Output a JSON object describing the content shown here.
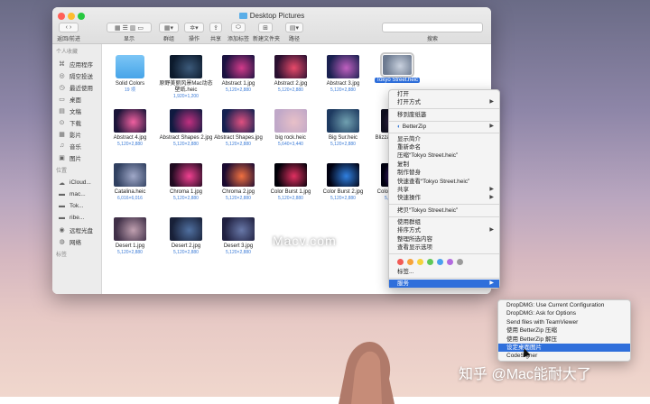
{
  "window": {
    "title": "Desktop Pictures",
    "toolbar_labels": {
      "back_forward": "返回/前进",
      "view": "显示",
      "group": "群组",
      "action": "操作",
      "share": "共享",
      "add_tags": "添加标签",
      "new_folder": "新建文件夹",
      "path": "路径",
      "search": "搜索"
    }
  },
  "sidebar": {
    "favorites_heading": "个人收藏",
    "favorites": [
      {
        "label": "应用程序",
        "icon": "apps-icon"
      },
      {
        "label": "隔空投送",
        "icon": "airdrop-icon"
      },
      {
        "label": "最近使用",
        "icon": "clock-icon"
      },
      {
        "label": "桌面",
        "icon": "desktop-icon"
      },
      {
        "label": "文稿",
        "icon": "document-icon"
      },
      {
        "label": "下载",
        "icon": "download-icon"
      },
      {
        "label": "影片",
        "icon": "film-icon"
      },
      {
        "label": "音乐",
        "icon": "music-icon"
      },
      {
        "label": "图片",
        "icon": "photo-icon"
      }
    ],
    "locations_heading": "位置",
    "locations": [
      {
        "label": "iCloud...",
        "icon": "cloud-icon"
      },
      {
        "label": "mac...",
        "icon": "disk-icon"
      },
      {
        "label": "Tok...",
        "icon": "disk-icon"
      },
      {
        "label": "ribe...",
        "icon": "disk-icon"
      },
      {
        "label": "远程光盘",
        "icon": "optical-disc-icon"
      },
      {
        "label": "网络",
        "icon": "network-icon"
      }
    ],
    "tags_heading": "标签"
  },
  "files": [
    {
      "name": "Solid Colors",
      "meta": "19 项",
      "kind": "folder"
    },
    {
      "name": "原野美丽风景Mac动态壁纸.heic",
      "meta": "1,920×1,200",
      "colors": [
        "#0c1a2c",
        "#3c5a7a"
      ]
    },
    {
      "name": "Abstract 1.jpg",
      "meta": "5,120×2,880",
      "colors": [
        "#1a1240",
        "#d23a8a"
      ]
    },
    {
      "name": "Abstract 2.jpg",
      "meta": "5,120×2,880",
      "colors": [
        "#2a1030",
        "#e84a6a"
      ]
    },
    {
      "name": "Abstract 3.jpg",
      "meta": "5,120×2,880",
      "colors": [
        "#1a2050",
        "#c060c0"
      ]
    },
    {
      "name": "Tokyo Street.heic",
      "meta": "",
      "colors": [
        "#6c7a90",
        "#c9d1de"
      ],
      "selected": true
    },
    {
      "name": "Abstract 4.jpg",
      "meta": "5,120×2,880",
      "colors": [
        "#1a1438",
        "#f060a0"
      ]
    },
    {
      "name": "Abstract Shapes 2.jpg",
      "meta": "5,120×2,880",
      "colors": [
        "#101a40",
        "#c03080"
      ]
    },
    {
      "name": "Abstract Shapes.jpg",
      "meta": "5,120×2,880",
      "colors": [
        "#142050",
        "#e05080"
      ]
    },
    {
      "name": "big rock.heic",
      "meta": "5,640×3,440",
      "colors": [
        "#c0a8c8",
        "#e8c0c8"
      ]
    },
    {
      "name": "Big Sur.heic",
      "meta": "5,120×2,880",
      "colors": [
        "#1e3a60",
        "#70a0b0"
      ]
    },
    {
      "name": "Blizzard Entertai...器.heic",
      "meta": "",
      "colors": [
        "#101020",
        "#604080"
      ]
    },
    {
      "name": "Catalina.heic",
      "meta": "6,016×6,016",
      "colors": [
        "#304060",
        "#a0a8c8"
      ]
    },
    {
      "name": "Chroma 1.jpg",
      "meta": "5,120×2,880",
      "colors": [
        "#200a20",
        "#f04090"
      ]
    },
    {
      "name": "Chroma 2.jpg",
      "meta": "5,120×2,880",
      "colors": [
        "#1a0a30",
        "#f07040"
      ]
    },
    {
      "name": "Color Burst 1.jpg",
      "meta": "5,120×2,880",
      "colors": [
        "#000008",
        "#e03060"
      ]
    },
    {
      "name": "Color Burst 2.jpg",
      "meta": "5,120×2,880",
      "colors": [
        "#000010",
        "#3080e0"
      ]
    },
    {
      "name": "Color Burst 3.jpg",
      "meta": "5,120×2,880",
      "colors": [
        "#000010",
        "#8040e0"
      ]
    },
    {
      "name": "Desert 1.jpg",
      "meta": "5,120×2,880",
      "colors": [
        "#403048",
        "#c0a0b0"
      ]
    },
    {
      "name": "Desert 2.jpg",
      "meta": "5,120×2,880",
      "colors": [
        "#182038",
        "#5070a0"
      ]
    },
    {
      "name": "Desert 3.jpg",
      "meta": "5,120×2,880",
      "colors": [
        "#202040",
        "#6878a8"
      ]
    }
  ],
  "context_menu": {
    "items": [
      {
        "label": "打开"
      },
      {
        "label": "打开方式",
        "submenu": true
      },
      {
        "sep": true
      },
      {
        "label": "移到废纸篓"
      },
      {
        "sep": true
      },
      {
        "label": "BetterZip",
        "submenu": true,
        "icon": "betterzip-icon"
      },
      {
        "sep": true
      },
      {
        "label": "显示简介"
      },
      {
        "label": "重新命名"
      },
      {
        "label": "压缩“Tokyo Street.heic”"
      },
      {
        "label": "复制"
      },
      {
        "label": "制作替身"
      },
      {
        "label": "快速查看“Tokyo Street.heic”"
      },
      {
        "label": "共享",
        "submenu": true
      },
      {
        "label": "快速操作",
        "submenu": true
      },
      {
        "sep": true
      },
      {
        "label": "拷贝“Tokyo Street.heic”"
      },
      {
        "sep": true
      },
      {
        "label": "使用群组"
      },
      {
        "label": "排序方式",
        "submenu": true
      },
      {
        "label": "整理所选内容"
      },
      {
        "label": "查看显示选项"
      },
      {
        "sep": true
      },
      {
        "tags": true
      },
      {
        "label": "标签..."
      },
      {
        "sep": true
      },
      {
        "label": "服务",
        "submenu": true,
        "highlight": true
      }
    ],
    "tag_colors": [
      "#f25a55",
      "#f6a23a",
      "#f5d23c",
      "#5fc857",
      "#4aa0ef",
      "#b26adf",
      "#9b9b9b"
    ]
  },
  "services_menu": {
    "items": [
      {
        "label": "DropDMG: Use Current Configuration"
      },
      {
        "label": "DropDMG: Ask for Options"
      },
      {
        "label": "Send files with TeamViewer"
      },
      {
        "label": "使用 BetterZip 压缩"
      },
      {
        "label": "使用 BetterZip 解压"
      },
      {
        "label": "设定桌面图片",
        "highlight": true
      },
      {
        "label": "CodeSigner"
      }
    ]
  },
  "watermarks": {
    "center": "Macv.com",
    "corner": "知乎 @Mac能耐大了"
  }
}
